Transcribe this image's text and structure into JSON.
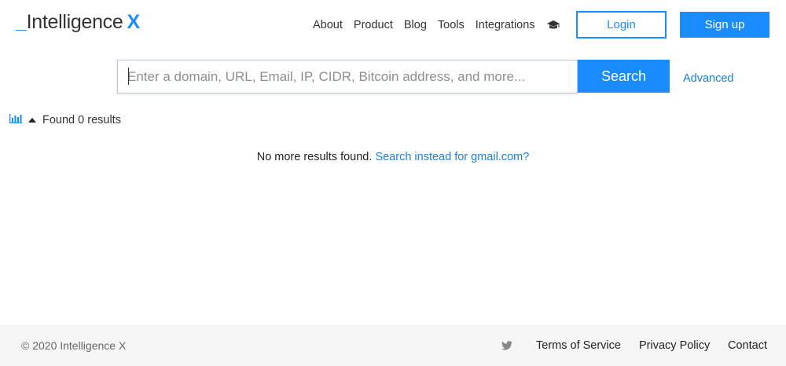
{
  "header": {
    "logo": {
      "underscore": "_",
      "name": "Intelligence",
      "x": "X"
    },
    "nav": [
      "About",
      "Product",
      "Blog",
      "Tools",
      "Integrations"
    ],
    "cap_icon": "graduation-cap-icon",
    "login_label": "Login",
    "signup_label": "Sign up"
  },
  "search": {
    "placeholder": "Enter a domain, URL, Email, IP, CIDR, Bitcoin address, and more...",
    "value": "",
    "button_label": "Search",
    "advanced_label": "Advanced"
  },
  "results": {
    "chart_icon": "bar-chart-icon",
    "toggle_icon": "triangle-up-icon",
    "found_text": "Found 0 results",
    "no_more_text": "No more results found.",
    "suggestion_text": "Search instead for gmail.com?"
  },
  "footer": {
    "copyright": "© 2020 Intelligence X",
    "twitter_icon": "twitter-icon",
    "terms_label": "Terms of Service",
    "privacy_label": "Privacy Policy",
    "contact_label": "Contact"
  },
  "colors": {
    "accent": "#1a8cff",
    "link": "#1a7fe0",
    "footer_bg": "#f6f6f6"
  }
}
